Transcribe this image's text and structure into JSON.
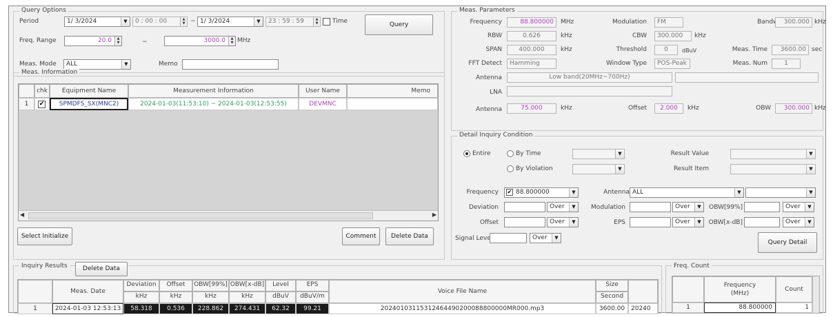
{
  "query_options": {
    "title": "Query Options",
    "period_label": "Period",
    "period_start_date": "1/ 3/2024",
    "period_start_time": "0 : 00 : 00",
    "period_sep": "~",
    "period_end_date": "1/ 3/2024",
    "period_end_time": "23 : 59 : 59",
    "time_label": "Time",
    "query_button": "Query",
    "freq_range_label": "Freq. Range",
    "freq_min": "20.0",
    "freq_sep": "~",
    "freq_max": "3000.0",
    "freq_unit": "MHz",
    "meas_mode_label": "Meas. Mode",
    "meas_mode_value": "ALL",
    "memo_label": "Memo",
    "memo_value": ""
  },
  "meas_information": {
    "title": "Meas. Information",
    "columns": [
      "",
      "chk",
      "Equipment Name",
      "Measurement Information",
      "User Name",
      "Memo"
    ],
    "rows": [
      {
        "num": "1",
        "checked": "✔",
        "equipment": "SPMDFS_SX(MNC2)",
        "info": "2024-01-03(11:53:10) ~ 2024-01-03(12:53:55)",
        "user": "DEVMNC",
        "memo": ""
      }
    ],
    "select_initialize_button": "Select Initialize",
    "comment_button": "Comment",
    "delete_data_button": "Delete Data"
  },
  "meas_parameters": {
    "title": "Meas. Parameters",
    "frequency_label": "Frequency",
    "frequency_value": "88.800000",
    "frequency_unit": "MHz",
    "modulation_label": "Modulation",
    "modulation_value": "FM",
    "bandwidth_label": "Bandwidth",
    "bandwidth_value": "300.000",
    "bandwidth_unit": "kHz",
    "rbw_label": "RBW",
    "rbw_value": "0.626",
    "rbw_unit": "kHz",
    "cbw_label": "CBW",
    "cbw_value": "300.000",
    "cbw_unit": "kHz",
    "span_label": "SPAN",
    "span_value": "400.000",
    "span_unit": "kHz",
    "threshold_label": "Threshold",
    "threshold_value": "0",
    "threshold_unit": "dBuV",
    "meas_time_label": "Meas. Time",
    "meas_time_value": "3600.00",
    "meas_time_unit": "sec",
    "fft_detect_label": "FFT Detect",
    "fft_detect_value": "Hamming",
    "window_type_label": "Window Type",
    "window_type_value": "POS-Peak",
    "meas_num_label": "Meas. Num",
    "meas_num_value": "1",
    "antenna_label": "Antenna",
    "antenna_value": "Low band(20MHz~700Hz)",
    "lna_label": "LNA",
    "lna_value": "",
    "antenna2_label": "Antenna",
    "antenna2_value": "75.000",
    "antenna2_unit": "kHz",
    "offset_label": "Offset",
    "offset_value": "2.000",
    "offset_unit": "kHz",
    "obw_label": "OBW",
    "obw_value": "300.000",
    "obw_unit": "kHz"
  },
  "detail_inquiry": {
    "title": "Detail Inquiry Condition",
    "entire_label": "Entire",
    "by_time_label": "By Time",
    "by_violation_label": "By Violation",
    "result_value_label": "Result Value",
    "result_item_label": "Result Item",
    "frequency_label": "Frequency",
    "frequency_value": "88.800000",
    "antenna_label": "Antenna",
    "antenna_value": "ALL",
    "deviation_label": "Deviation",
    "modulation_label": "Modulation",
    "obw99_label": "OBW[99%]",
    "offset_label": "Offset",
    "eps_label": "EPS",
    "obwx_label": "OBW[x-dB]",
    "signal_level_label": "Signal Level",
    "over_value": "Over",
    "query_detail_button": "Query Detail"
  },
  "inquiry_results": {
    "title": "Inquiry Results",
    "delete_data_button": "Delete Data",
    "columns": [
      {
        "name": "Meas. Date",
        "unit": ""
      },
      {
        "name": "Deviation",
        "unit": "kHz"
      },
      {
        "name": "Offset",
        "unit": "kHz"
      },
      {
        "name": "OBW[99%]",
        "unit": "kHz"
      },
      {
        "name": "OBW[x-dB]",
        "unit": "kHz"
      },
      {
        "name": "Level",
        "unit": "dBuV"
      },
      {
        "name": "EPS",
        "unit": "dBuV/m"
      },
      {
        "name": "Voice File Name",
        "unit": ""
      },
      {
        "name": "Size",
        "unit": "Second"
      }
    ],
    "rows": [
      {
        "num": "1",
        "date": "2024-01-03 12:53:13",
        "deviation": "58.318",
        "offset": "0.536",
        "obw99": "228.862",
        "obwx": "274.431",
        "level": "62.32",
        "eps": "99.21",
        "voice_file": "20240103115312464490200088800000MR000.mp3",
        "size": "3600.00",
        "extra": "20240"
      }
    ]
  },
  "freq_count": {
    "title": "Freq. Count",
    "col_frequency": "Frequency",
    "col_frequency_unit": "(MHz)",
    "col_count": "Count",
    "rows": [
      {
        "num": "1",
        "frequency": "88.800000",
        "count": "1"
      }
    ]
  }
}
